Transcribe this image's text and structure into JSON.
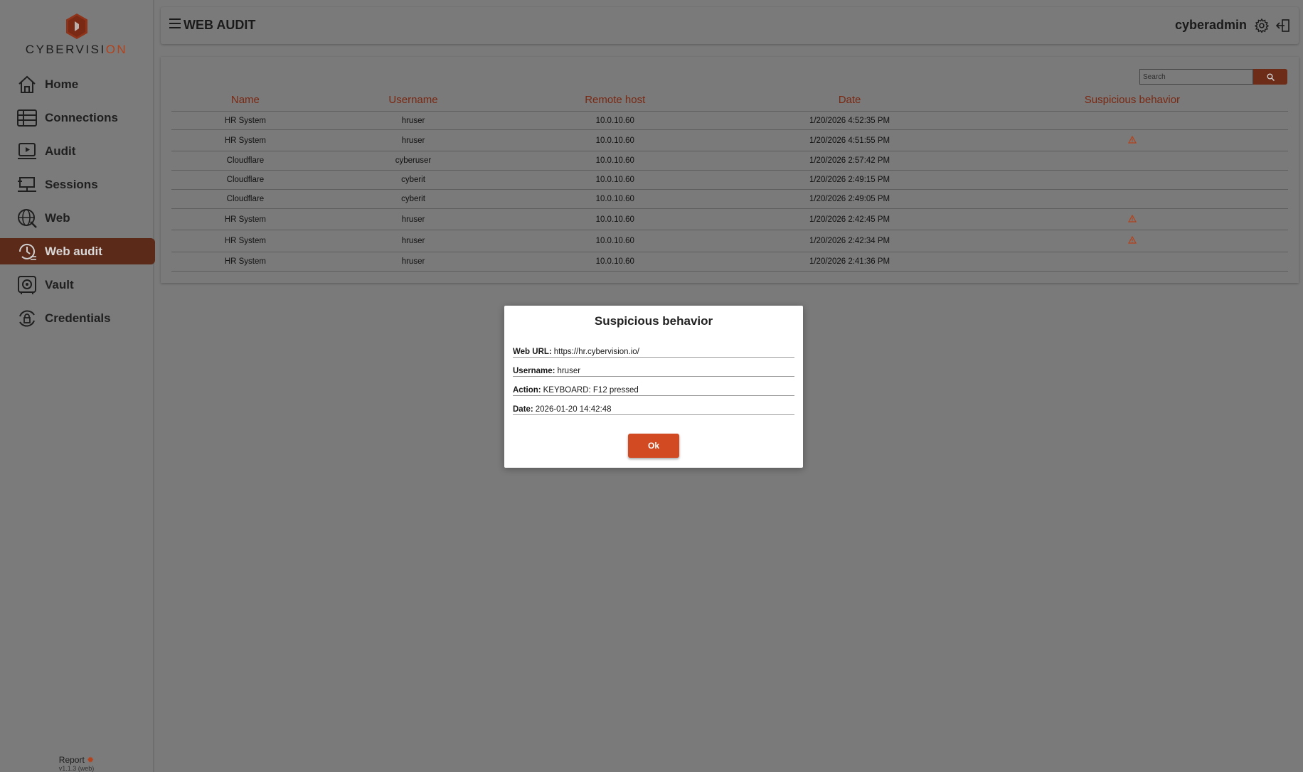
{
  "brand": {
    "logo_text_main": "CYBERVISI",
    "logo_text_accent": "ON"
  },
  "sidebar": {
    "items": [
      {
        "label": "Home",
        "icon": "home-icon",
        "active": false
      },
      {
        "label": "Connections",
        "icon": "connections-icon",
        "active": false
      },
      {
        "label": "Audit",
        "icon": "audit-icon",
        "active": false
      },
      {
        "label": "Sessions",
        "icon": "sessions-icon",
        "active": false
      },
      {
        "label": "Web",
        "icon": "globe-icon",
        "active": false
      },
      {
        "label": "Web audit",
        "icon": "web-audit-icon",
        "active": true
      },
      {
        "label": "Vault",
        "icon": "vault-icon",
        "active": false
      },
      {
        "label": "Credentials",
        "icon": "credentials-icon",
        "active": false
      }
    ],
    "report_label": "Report",
    "version": "v1.1.3 (web)"
  },
  "header": {
    "title": "WEB AUDIT",
    "username": "cyberadmin"
  },
  "search": {
    "placeholder": "Search"
  },
  "table": {
    "columns": [
      "Name",
      "Username",
      "Remote host",
      "Date",
      "Suspicious behavior"
    ],
    "rows": [
      {
        "name": "HR System",
        "username": "hruser",
        "host": "10.0.10.60",
        "date": "1/20/2026 4:52:35 PM",
        "suspicious": false
      },
      {
        "name": "HR System",
        "username": "hruser",
        "host": "10.0.10.60",
        "date": "1/20/2026 4:51:55 PM",
        "suspicious": true
      },
      {
        "name": "Cloudflare",
        "username": "cyberuser",
        "host": "10.0.10.60",
        "date": "1/20/2026 2:57:42 PM",
        "suspicious": false
      },
      {
        "name": "Cloudflare",
        "username": "cyberit",
        "host": "10.0.10.60",
        "date": "1/20/2026 2:49:15 PM",
        "suspicious": false
      },
      {
        "name": "Cloudflare",
        "username": "cyberit",
        "host": "10.0.10.60",
        "date": "1/20/2026 2:49:05 PM",
        "suspicious": false
      },
      {
        "name": "HR System",
        "username": "hruser",
        "host": "10.0.10.60",
        "date": "1/20/2026 2:42:45 PM",
        "suspicious": true
      },
      {
        "name": "HR System",
        "username": "hruser",
        "host": "10.0.10.60",
        "date": "1/20/2026 2:42:34 PM",
        "suspicious": true
      },
      {
        "name": "HR System",
        "username": "hruser",
        "host": "10.0.10.60",
        "date": "1/20/2026 2:41:36 PM",
        "suspicious": false
      }
    ]
  },
  "modal": {
    "title": "Suspicious behavior",
    "fields": [
      {
        "label": "Web URL:",
        "value": "https://hr.cybervision.io/"
      },
      {
        "label": "Username:",
        "value": "hruser"
      },
      {
        "label": "Action:",
        "value": "KEYBOARD: F12 pressed"
      },
      {
        "label": "Date:",
        "value": "2026-01-20 14:42:48"
      }
    ],
    "ok_label": "Ok"
  },
  "colors": {
    "accent": "#d24a22",
    "active_nav": "#5b2a19",
    "warning": "#b5411a"
  }
}
